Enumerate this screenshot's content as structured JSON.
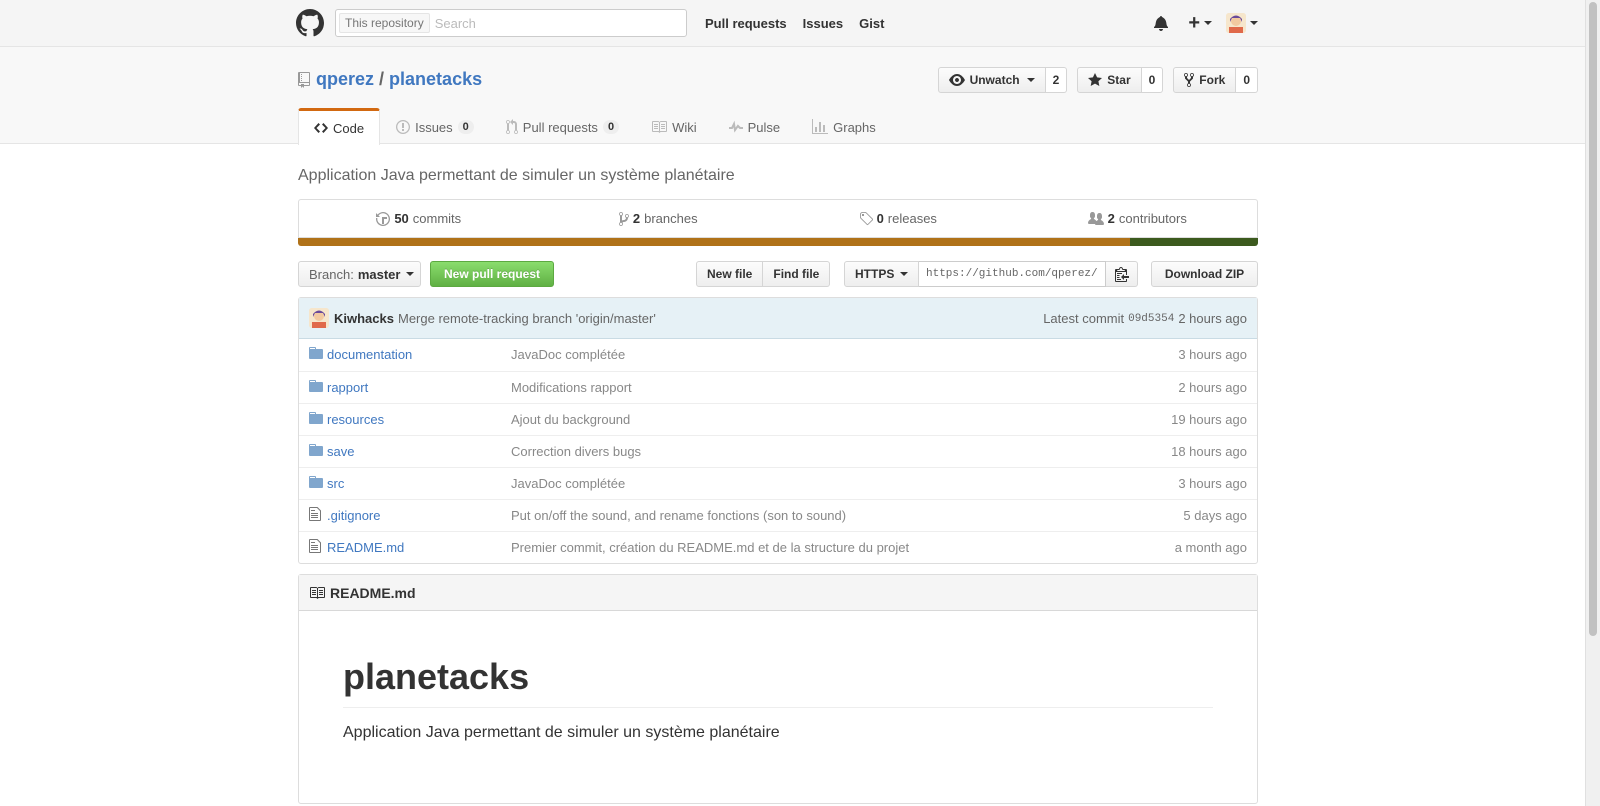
{
  "header": {
    "search_scope": "This repository",
    "search_placeholder": "Search",
    "nav": [
      "Pull requests",
      "Issues",
      "Gist"
    ]
  },
  "repo": {
    "owner": "qperez",
    "separator": "/",
    "name": "planetacks",
    "watch_label": "Unwatch",
    "watch_count": "2",
    "star_label": "Star",
    "star_count": "0",
    "fork_label": "Fork",
    "fork_count": "0"
  },
  "tabs": [
    {
      "label": "Code",
      "icon": "code-icon",
      "selected": true
    },
    {
      "label": "Issues",
      "icon": "issue-icon",
      "counter": "0"
    },
    {
      "label": "Pull requests",
      "icon": "pull-request-icon",
      "counter": "0"
    },
    {
      "label": "Wiki",
      "icon": "book-icon"
    },
    {
      "label": "Pulse",
      "icon": "pulse-icon"
    },
    {
      "label": "Graphs",
      "icon": "graph-icon"
    }
  ],
  "description": "Application Java permettant de simuler un système planétaire",
  "summary": {
    "commits_num": "50",
    "commits_label": "commits",
    "branches_num": "2",
    "branches_label": "branches",
    "releases_num": "0",
    "releases_label": "releases",
    "contributors_num": "2",
    "contributors_label": "contributors"
  },
  "language_bar": [
    {
      "color": "#b07219",
      "percent": 86.7
    },
    {
      "color": "#3c5a1e",
      "percent": 13.3
    }
  ],
  "file_nav": {
    "branch_prefix": "Branch:",
    "branch_name": "master",
    "new_pr": "New pull request",
    "new_file": "New file",
    "find_file": "Find file",
    "protocol": "HTTPS",
    "clone_url": "https://github.com/qperez/planetacks.git",
    "download": "Download ZIP"
  },
  "latest_commit": {
    "author": "Kiwhacks",
    "message": "Merge remote-tracking branch 'origin/master'",
    "label": "Latest commit",
    "sha": "09d5354",
    "age": "2 hours ago"
  },
  "files": [
    {
      "type": "dir",
      "name": "documentation",
      "message": "JavaDoc complétée",
      "age": "3 hours ago"
    },
    {
      "type": "dir",
      "name": "rapport",
      "message": "Modifications rapport",
      "age": "2 hours ago"
    },
    {
      "type": "dir",
      "name": "resources",
      "message": "Ajout du background",
      "age": "19 hours ago"
    },
    {
      "type": "dir",
      "name": "save",
      "message": "Correction divers bugs",
      "age": "18 hours ago"
    },
    {
      "type": "dir",
      "name": "src",
      "message": "JavaDoc complétée",
      "age": "3 hours ago"
    },
    {
      "type": "file",
      "name": ".gitignore",
      "message": "Put on/off the sound, and rename fonctions (son to sound)",
      "age": "5 days ago"
    },
    {
      "type": "file",
      "name": "README.md",
      "message": "Premier commit, création du README.md et de la structure du projet",
      "age": "a month ago"
    }
  ],
  "readme": {
    "filename": "README.md",
    "heading": "planetacks",
    "body": "Application Java permettant de simuler un système planétaire"
  }
}
